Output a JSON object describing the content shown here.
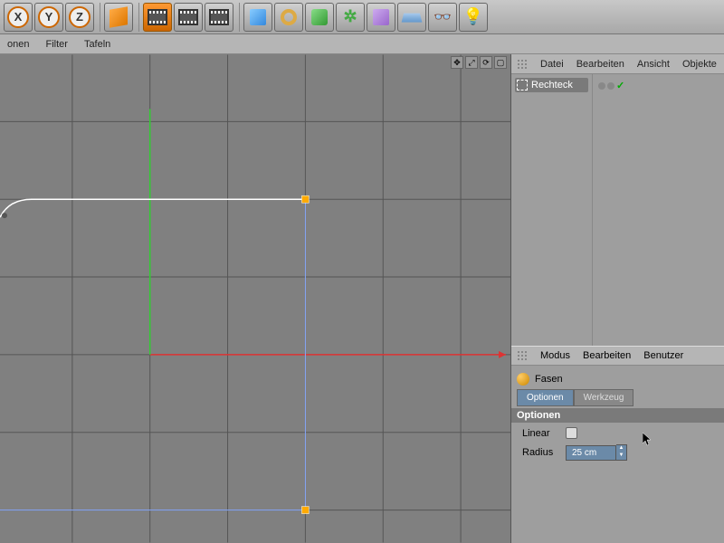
{
  "toolbar": {
    "axis_x": "X",
    "axis_y": "Y",
    "axis_z": "Z"
  },
  "viewport_menu": {
    "items": [
      "onen",
      "Filter",
      "Tafeln"
    ]
  },
  "object_menu": {
    "items": [
      "Datei",
      "Bearbeiten",
      "Ansicht",
      "Objekte"
    ]
  },
  "object_tree": {
    "item_name": "Rechteck"
  },
  "attr_menu": {
    "items": [
      "Modus",
      "Bearbeiten",
      "Benutzer"
    ]
  },
  "tool": {
    "name": "Fasen",
    "tabs": [
      "Optionen",
      "Werkzeug"
    ],
    "section": "Optionen",
    "linear_label": "Linear",
    "radius_label": "Radius",
    "radius_value": "25 cm"
  }
}
